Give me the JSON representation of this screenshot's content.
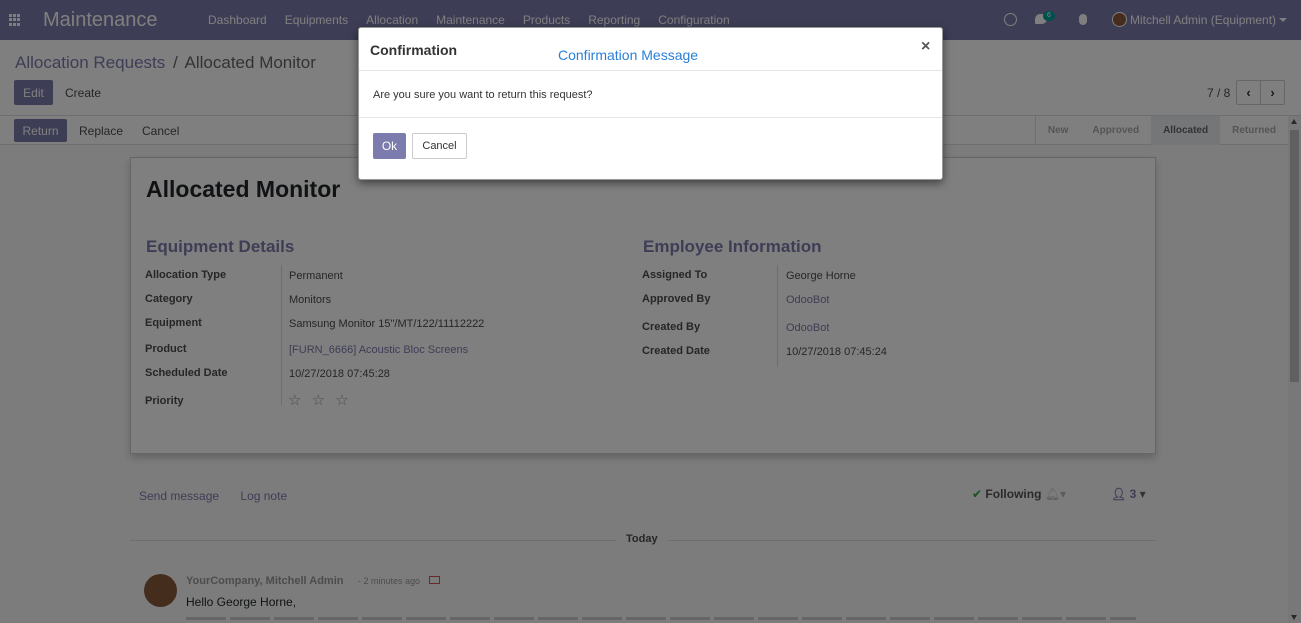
{
  "app": {
    "title": "Maintenance"
  },
  "menu": [
    "Dashboard",
    "Equipments",
    "Allocation",
    "Maintenance",
    "Products",
    "Reporting",
    "Configuration"
  ],
  "systray": {
    "chat_badge": "6",
    "user": "Mitchell Admin (Equipment)"
  },
  "breadcrumb": {
    "parent": "Allocation Requests",
    "separator": "/",
    "current": "Allocated Monitor"
  },
  "buttons": {
    "edit": "Edit",
    "create": "Create",
    "return": "Return",
    "replace": "Replace",
    "cancel": "Cancel"
  },
  "pager": {
    "value": "7 / 8"
  },
  "stages": {
    "items": [
      "New",
      "Approved",
      "Allocated",
      "Returned"
    ],
    "active": "Allocated"
  },
  "record": {
    "title": "Allocated Monitor",
    "equipment_details": {
      "heading": "Equipment Details",
      "fields": [
        {
          "label": "Allocation Type",
          "value": "Permanent"
        },
        {
          "label": "Category",
          "value": "Monitors"
        },
        {
          "label": "Equipment",
          "value": "Samsung Monitor 15\"/MT/122/11112222"
        },
        {
          "label": "Product",
          "value": "[FURN_6666] Acoustic Bloc Screens"
        },
        {
          "label": "Scheduled Date",
          "value": "10/27/2018 07:45:28"
        },
        {
          "label": "Priority",
          "value": "☆ ☆ ☆"
        }
      ]
    },
    "employee_info": {
      "heading": "Employee Information",
      "fields": [
        {
          "label": "Assigned To",
          "value": "George Horne"
        },
        {
          "label": "Approved By",
          "value": "OdooBot"
        },
        {
          "label": "Created By",
          "value": "OdooBot"
        },
        {
          "label": "Created Date",
          "value": "10/27/2018 07:45:24"
        }
      ]
    }
  },
  "chatter": {
    "send_message": "Send message",
    "log_note": "Log note",
    "following": "Following",
    "followers_count": "3",
    "date_separator": "Today",
    "message": {
      "author": "YourCompany, Mitchell Admin",
      "date": "- 2 minutes ago",
      "body": "Hello George Horne,"
    }
  },
  "dialog": {
    "title": "Confirmation",
    "subtitle": "Confirmation Message",
    "close": "×",
    "body": "Are you sure you want to return this request?",
    "ok": "Ok",
    "cancel": "Cancel"
  }
}
